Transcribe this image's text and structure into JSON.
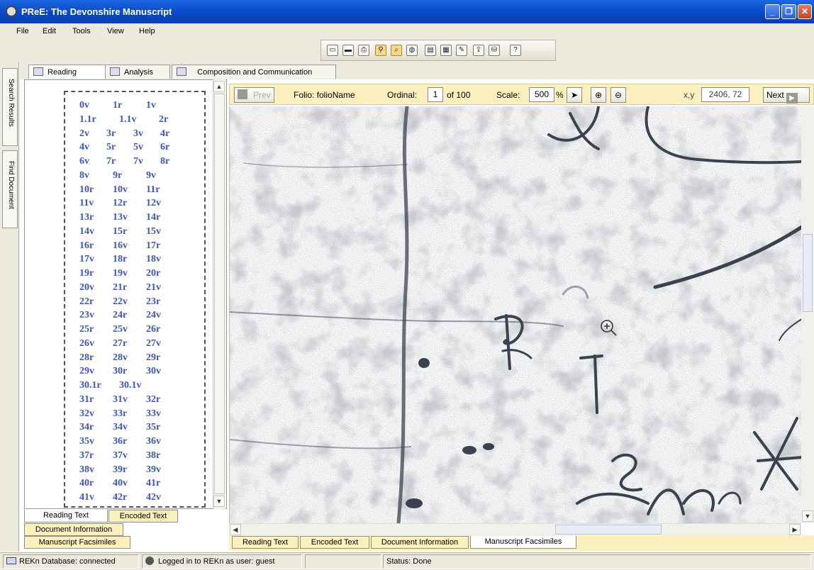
{
  "window": {
    "title": "PReE: The Devonshire Manuscript"
  },
  "menubar": {
    "items": [
      "File",
      "Edit",
      "Tools",
      "View",
      "Help"
    ]
  },
  "toolbar": {
    "icons": [
      "open-folder-icon",
      "scroll-icon",
      "print-icon",
      "binoculars-icon",
      "search-zoom-icon",
      "globe-icon",
      "document-search-icon",
      "analysis-icon",
      "edit-icon",
      "export-icon",
      "database-icon",
      "help-icon"
    ]
  },
  "side_tabs": [
    "Search Results",
    "Find Document"
  ],
  "top_tabs": [
    "Reading",
    "Analysis",
    "Composition and Communication"
  ],
  "folio_rows": [
    [
      "0v",
      "1r",
      "1v"
    ],
    [
      "1.1r",
      "1.1v",
      "2r"
    ],
    [
      "2v",
      "3r",
      "3v",
      "4r"
    ],
    [
      "4v",
      "5r",
      "5v",
      "6r"
    ],
    [
      "6v",
      "7r",
      "7v",
      "8r"
    ],
    [
      "8v",
      "9r",
      "9v"
    ],
    [
      "10r",
      "10v",
      "11r"
    ],
    [
      "11v",
      "12r",
      "12v"
    ],
    [
      "13r",
      "13v",
      "14r"
    ],
    [
      "14v",
      "15r",
      "15v"
    ],
    [
      "16r",
      "16v",
      "17r"
    ],
    [
      "17v",
      "18r",
      "18v"
    ],
    [
      "19r",
      "19v",
      "20r"
    ],
    [
      "20v",
      "21r",
      "21v"
    ],
    [
      "22r",
      "22v",
      "23r"
    ],
    [
      "23v",
      "24r",
      "24v"
    ],
    [
      "25r",
      "25v",
      "26r"
    ],
    [
      "26v",
      "27r",
      "27v"
    ],
    [
      "28r",
      "28v",
      "29r"
    ],
    [
      "29v",
      "30r",
      "30v"
    ],
    [
      "30.1r",
      "30.1v"
    ],
    [
      "31r",
      "31v",
      "32r"
    ],
    [
      "32v",
      "33r",
      "33v"
    ],
    [
      "34r",
      "34v",
      "35r"
    ],
    [
      "35v",
      "36r",
      "36v"
    ],
    [
      "37r",
      "37v",
      "38r"
    ],
    [
      "38v",
      "39r",
      "39v"
    ],
    [
      "40r",
      "40v",
      "41r"
    ],
    [
      "41v",
      "42r",
      "42v"
    ]
  ],
  "left_bottom_tabs": {
    "reading_text": "Reading Text",
    "encoded_text": "Encoded Text",
    "document_information": "Document Information",
    "manuscript_facsimiles": "Manuscript Facsimiles"
  },
  "viewer": {
    "prev_label": "Prev",
    "folio_label": "Folio: folioName",
    "ordinal_label": "Ordinal:",
    "ordinal_value": "1",
    "ordinal_total": "of 100",
    "scale_label": "Scale:",
    "scale_value": "500",
    "scale_unit": "%",
    "xy_label": "x,y",
    "xy_value": "2406, 72",
    "next_label": "Next"
  },
  "viewer_bottom_tabs": [
    "Reading Text",
    "Encoded Text",
    "Document Information",
    "Manuscript Facsimiles"
  ],
  "status": {
    "database": "REKn Database: connected",
    "user": "Logged in to REKn as user: guest",
    "status": "Status: Done"
  }
}
